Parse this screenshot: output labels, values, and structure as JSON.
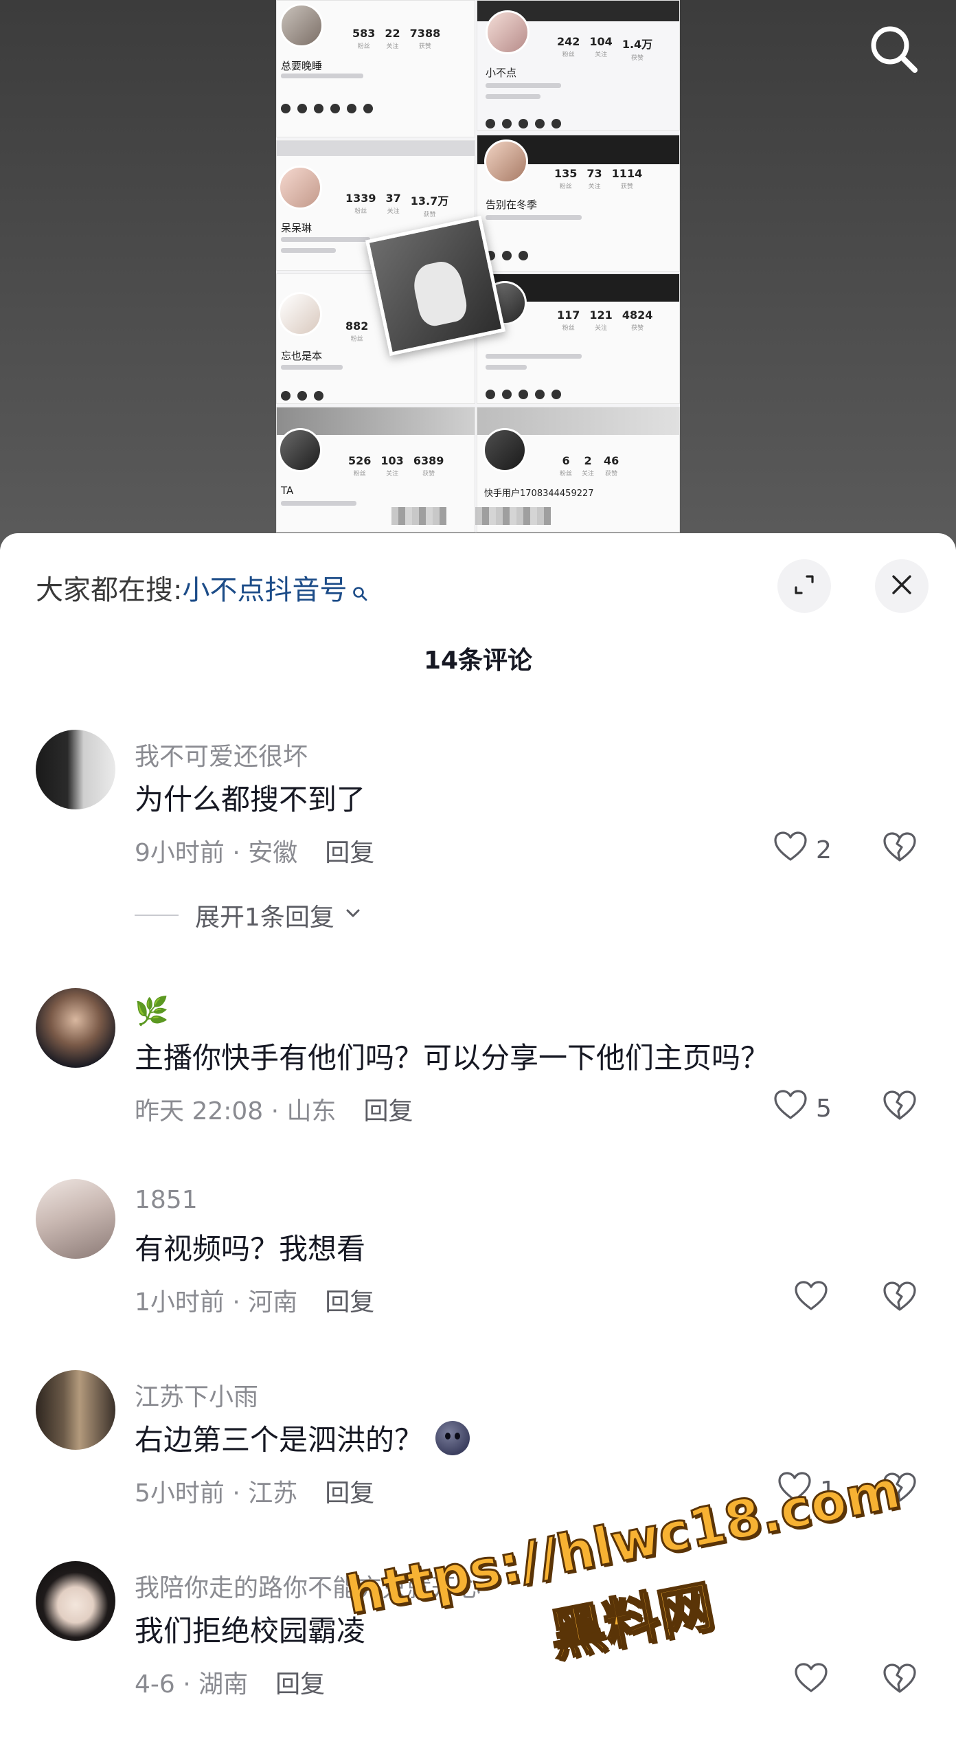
{
  "video": {
    "profiles": [
      {
        "name": "总要晚睡",
        "stats": [
          "583",
          "22",
          "7388"
        ]
      },
      {
        "name": "小不点",
        "stats": [
          "242",
          "104",
          "1.4万"
        ]
      },
      {
        "name": "呆呆琳",
        "stats": [
          "1339",
          "37",
          "13.7万"
        ]
      },
      {
        "name": "告别在冬季",
        "stats": [
          "135",
          "73",
          "1114"
        ]
      },
      {
        "name": "忘也是本",
        "stats": [
          "882"
        ]
      },
      {
        "name": "",
        "stats": [
          "117",
          "121",
          "4824"
        ]
      },
      {
        "name": "TA",
        "stats": [
          "526",
          "103",
          "6389"
        ]
      },
      {
        "name": "快手用户1708344459227",
        "stats": [
          "6",
          "2",
          "46"
        ]
      }
    ],
    "stat_labels": [
      "粉丝",
      "关注",
      "获赞"
    ]
  },
  "sheet": {
    "search_prefix": "大家都在搜:",
    "search_keyword": "小不点抖音号",
    "comment_count_title": "14条评论"
  },
  "comments": [
    {
      "user": "我不可爱还很坏",
      "text": "为什么都搜不到了",
      "time_location": "9小时前 · 安徽",
      "reply_label": "回复",
      "likes": "2",
      "expand_label": "展开1条回复"
    },
    {
      "user": "🌿",
      "text": "主播你快手有他们吗？可以分享一下他们主页吗？",
      "time_location": "昨天 22:08 · 山东",
      "reply_label": "回复",
      "likes": "5"
    },
    {
      "user": "1851",
      "text": "有视频吗？我想看",
      "time_location": "1小时前 · 河南",
      "reply_label": "回复",
      "likes": ""
    },
    {
      "user": "江苏下小雨",
      "text": "右边第三个是泗洪的？",
      "time_location": "5小时前 · 江苏",
      "reply_label": "回复",
      "likes": "1"
    },
    {
      "user": "我陪你走的路你不能充只就开心",
      "text": "我们拒绝校园霸凌",
      "time_location": "4-6 · 湖南",
      "reply_label": "回复",
      "likes": ""
    }
  ],
  "watermark": {
    "url": "https://hlwc18.com",
    "name": "黑料网"
  },
  "colors": {
    "keyword_blue": "#1c4c88",
    "secondary_text": "#8a8b91",
    "watermark_fill": "#f7b233",
    "watermark_stroke": "#5a3407"
  }
}
